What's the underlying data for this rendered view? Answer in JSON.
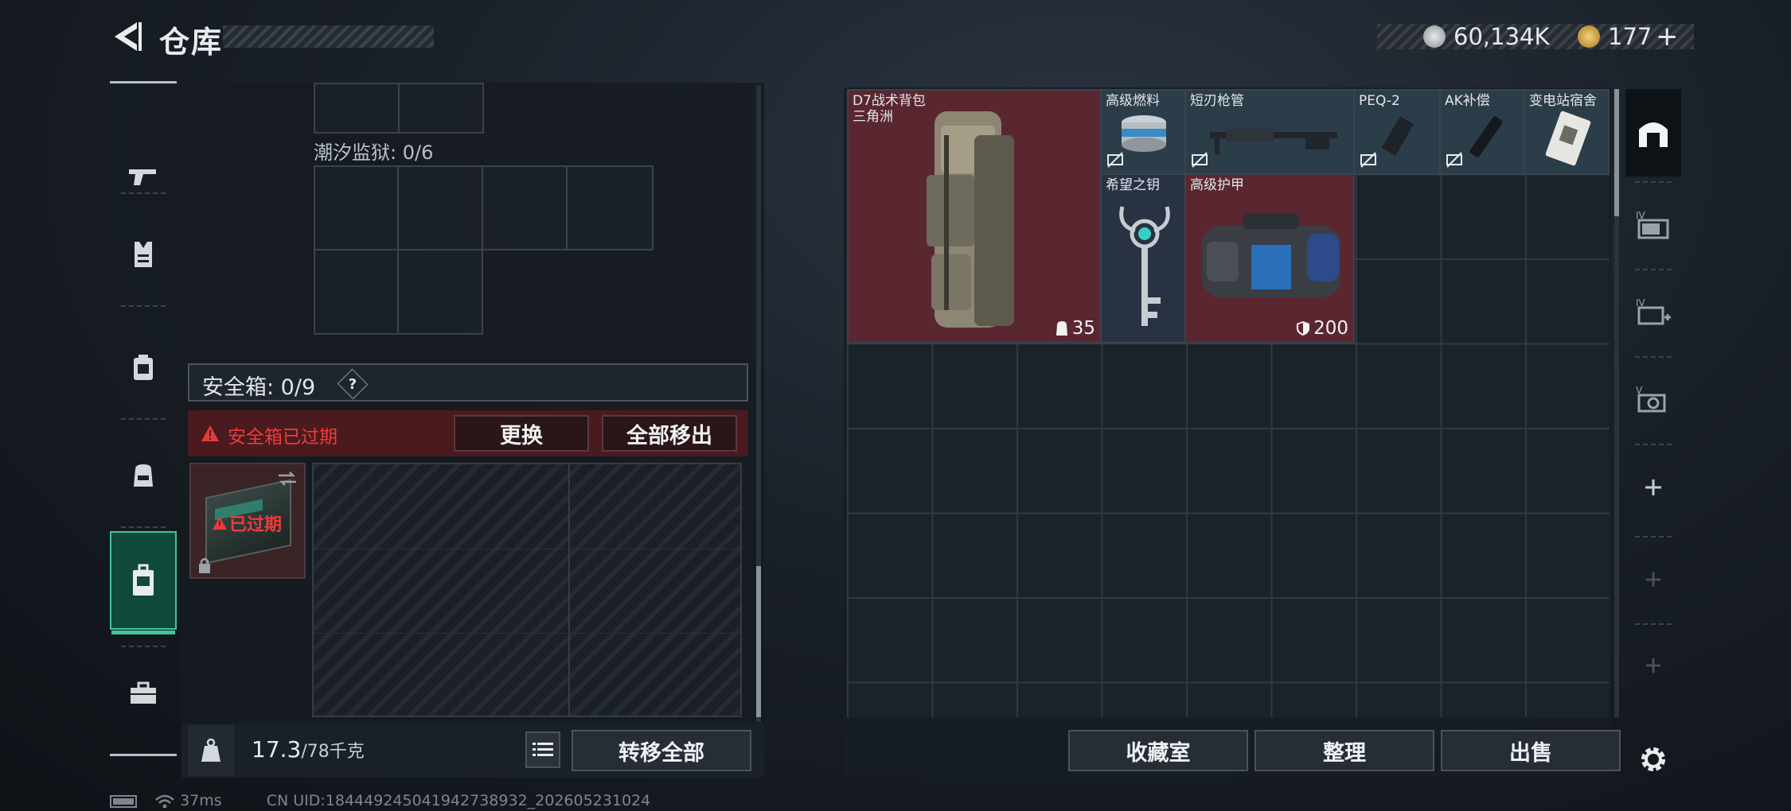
{
  "header": {
    "title": "仓库",
    "currency_silver": "60,134K",
    "currency_gold": "177",
    "currency_gold_plus": "+"
  },
  "left_panel": {
    "prison_label": "潮汐监狱: 0/6",
    "safe_box_label": "安全箱: 0/9",
    "safe_box_help": "?",
    "expired_warning": "安全箱已过期",
    "replace_button": "更换",
    "remove_all_button": "全部移出",
    "expired_tag": "已过期",
    "weight_value": "17.3",
    "weight_max": "/78千克",
    "transfer_all_button": "转移全部"
  },
  "inventory": {
    "items": [
      {
        "name": "D7战术背包",
        "sub": "三角洲",
        "count": "35"
      },
      {
        "name": "高级燃料"
      },
      {
        "name": "短刃枪管"
      },
      {
        "name": "PEQ-2"
      },
      {
        "name": "AK补偿"
      },
      {
        "name": "变电站宿舍"
      },
      {
        "name": "希望之钥"
      },
      {
        "name": "高级护甲",
        "count": "200"
      }
    ],
    "buttons": {
      "collection": "收藏室",
      "organize": "整理",
      "sell": "出售"
    }
  },
  "footer": {
    "ping": "37ms",
    "uid": "CN UID:184449245041942738932_202605231024"
  },
  "colors": {
    "accent_green": "#3fc69a",
    "item_red": "#5a2730",
    "warning_red": "#e23b3b"
  }
}
